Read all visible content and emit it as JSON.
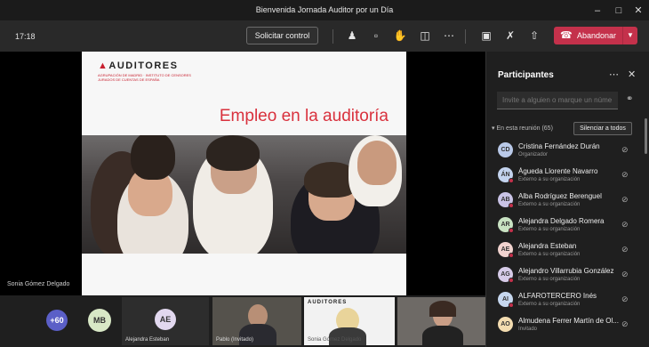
{
  "window": {
    "title": "Bienvenida Jornada Auditor por un Día"
  },
  "toolbar": {
    "timer": "17:18",
    "request_control": "Solicitar control",
    "leave_label": "Abandonar"
  },
  "stage": {
    "presenter_name": "Sonia Gómez Delgado",
    "slide": {
      "logo": "AUDITORES",
      "logo_sub": "AGRUPACIÓN DE MADRID · INSTITUTO DE CENSORES JURADOS DE CUENTAS DE ESPAÑA",
      "headline": "Empleo en la auditoría"
    }
  },
  "strip": {
    "more_count": "+60",
    "mb_initials": "MB",
    "ae_initials": "AE",
    "ae_name": "Alejandra Esteban",
    "tile_pablo": "Pablo (Invitado)",
    "tile_sonia": "Sonia Gómez Delgado",
    "tile_logo": "AUDITORES"
  },
  "panel": {
    "title": "Participantes",
    "invite_placeholder": "Invite a alguien o marque un núme",
    "section": "En esta reunión (65)",
    "mute_all": "Silenciar a todos",
    "participants": [
      {
        "initials": "CD",
        "name": "Cristina Fernández Durán",
        "role": "Organizador",
        "color": "#b9c9e8",
        "external": false
      },
      {
        "initials": "ÁN",
        "name": "Águeda Llorente Navarro",
        "role": "Externo a su organización",
        "color": "#c3d3ee",
        "external": true
      },
      {
        "initials": "AB",
        "name": "Alba Rodríguez Berenguel",
        "role": "Externo a su organización",
        "color": "#c9c3e6",
        "external": true
      },
      {
        "initials": "AR",
        "name": "Alejandra Delgado Romera",
        "role": "Externo a su organización",
        "color": "#c9e3c3",
        "external": true
      },
      {
        "initials": "AE",
        "name": "Alejandra Esteban",
        "role": "Externo a su organización",
        "color": "#f1d3cf",
        "external": true
      },
      {
        "initials": "AG",
        "name": "Alejandro Villarrubia González",
        "role": "Externo a su organización",
        "color": "#d6cbe8",
        "external": true
      },
      {
        "initials": "AI",
        "name": "ALFAROTERCERO Inés",
        "role": "Externo a su organización",
        "color": "#c6d7ef",
        "external": true
      },
      {
        "initials": "AO",
        "name": "Almudena Ferrer Martín de Ol...",
        "role": "Invitado",
        "color": "#f3dcb0",
        "external": false
      }
    ]
  },
  "colors": {
    "leave": "#c4314b",
    "headline": "#d9313d",
    "accent": "#6264a7"
  }
}
